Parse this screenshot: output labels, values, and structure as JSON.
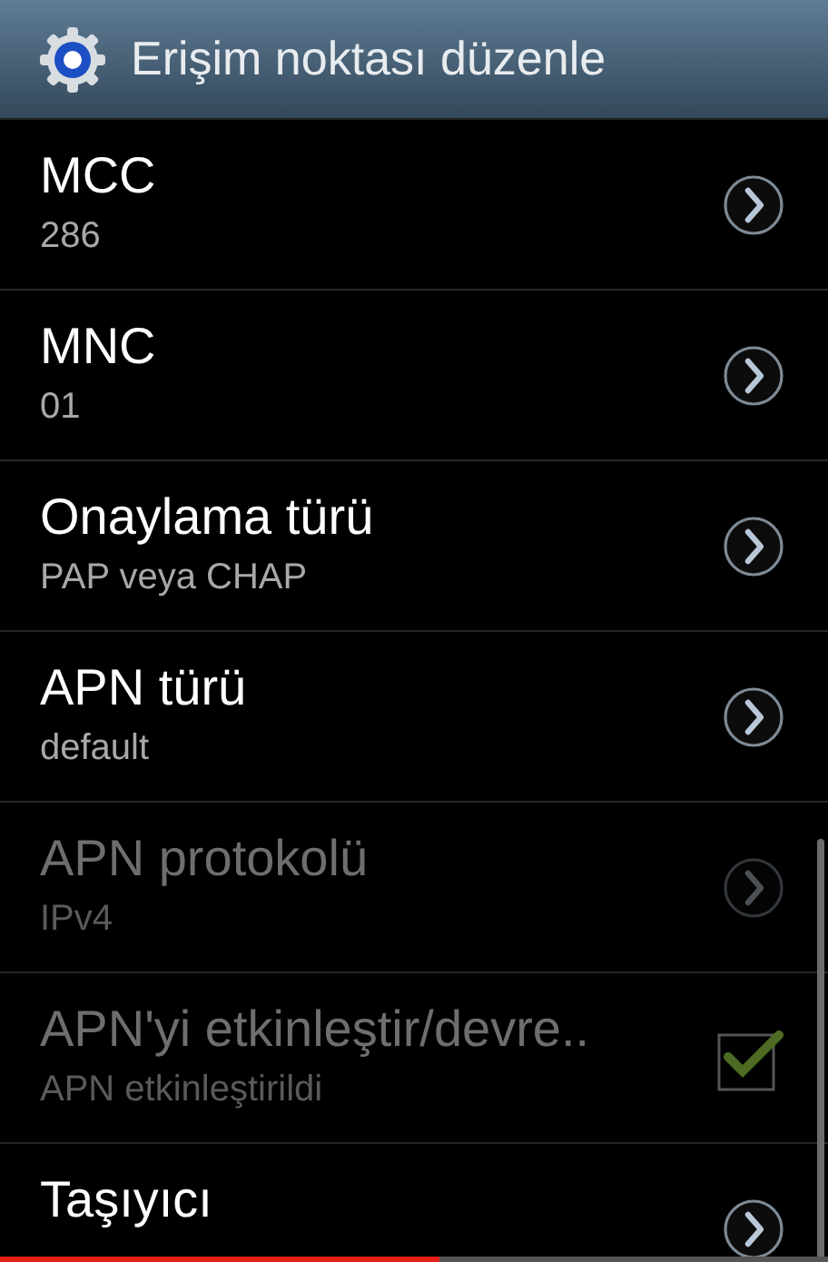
{
  "window": {
    "title": "Erişim noktası düzenle"
  },
  "settings": [
    {
      "kind": "chevron",
      "title": "MCC",
      "summary": "286",
      "disabled": false
    },
    {
      "kind": "chevron",
      "title": "MNC",
      "summary": "01",
      "disabled": false
    },
    {
      "kind": "chevron",
      "title": "Onaylama türü",
      "summary": "PAP veya CHAP",
      "disabled": false
    },
    {
      "kind": "chevron",
      "title": "APN türü",
      "summary": "default",
      "disabled": false
    },
    {
      "kind": "chevron",
      "title": "APN protokolü",
      "summary": "IPv4",
      "disabled": true
    },
    {
      "kind": "checkbox",
      "title": "APN'yi etkinleştir/devre..",
      "summary": "APN etkinleştirildi",
      "disabled": true,
      "checked": true
    },
    {
      "kind": "chevron",
      "title": "Taşıyıcı",
      "disabled": false
    }
  ],
  "video_progress": {
    "level": 0.53
  }
}
